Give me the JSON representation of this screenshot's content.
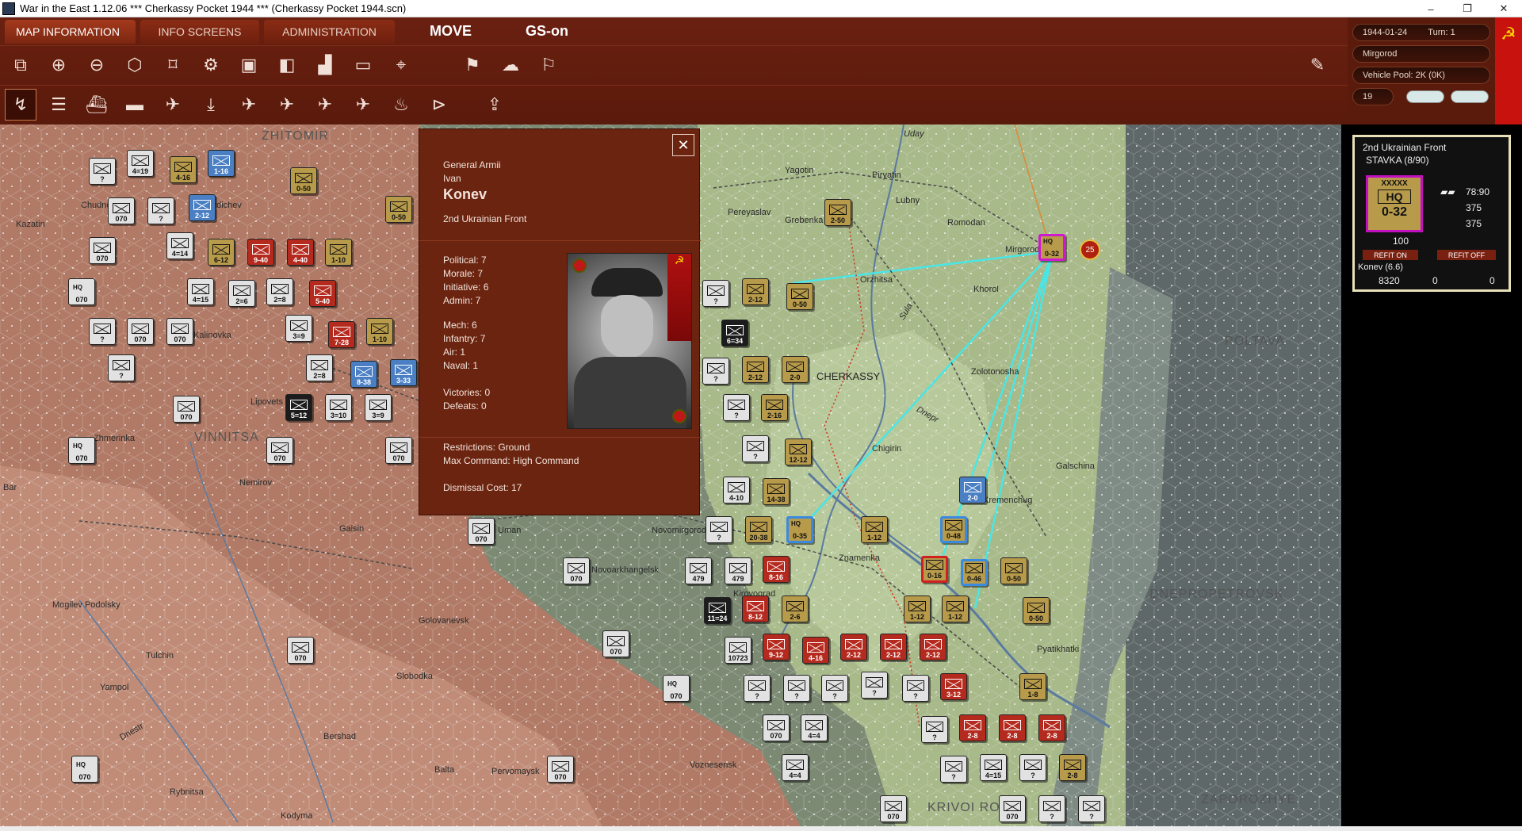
{
  "window": {
    "title": "War in the East 1.12.06       ***   Cherkassy Pocket 1944   ***   (Cherkassy Pocket 1944.scn)",
    "controls": [
      "–",
      "❐",
      "✕"
    ]
  },
  "menu": {
    "tabs": [
      "MAP INFORMATION",
      "INFO SCREENS",
      "ADMINISTRATION"
    ],
    "mode": "MOVE",
    "gs": "GS-on"
  },
  "toolbar_row1_icons": [
    "window-icon",
    "zoom-in-icon",
    "zoom-out-icon",
    "hexes-icon",
    "frame-icon",
    "gear-icon",
    "unit-stack-icon",
    "layers-icon",
    "chart-icon",
    "rectangle-icon",
    "focus-icon",
    "flag-box-icon",
    "weather-icon",
    "flag-icon",
    "pencil-icon"
  ],
  "toolbar_row2": {
    "keys": [
      "F1",
      "F2",
      "F3",
      "F4",
      "F5",
      "F6",
      "F7",
      "F8",
      "F9",
      "F10",
      "F11",
      "F12"
    ],
    "icons": [
      "move-mode-icon",
      "rail-icon",
      "naval-icon",
      "naval-transport-icon",
      "air-icon",
      "paradrop-icon",
      "air-attack-icon",
      "air-supply-icon",
      "bomb-icon",
      "recon-icon",
      "fire-icon",
      "play-icon",
      "upload-icon"
    ]
  },
  "status": {
    "date": "1944-01-24",
    "turn": "Turn: 1",
    "location": "Mirgorod",
    "vehicle_pool": "Vehicle Pool: 2K (0K)",
    "value": "19"
  },
  "commander": {
    "rank": "General Armii",
    "first_name": "Ivan",
    "last_name": "Konev",
    "command": "2nd Ukrainian Front",
    "political": "Political:   7",
    "morale": "Morale:    7",
    "initiative": "Initiative:   6",
    "admin": "Admin:     7",
    "mech": "Mech:      6",
    "infantry": "Infantry:   7",
    "air": "Air:          1",
    "naval": "Naval:      1",
    "victories": "Victories:    0",
    "defeats": "Defeats:      0",
    "restrictions": "Restrictions:      Ground",
    "max_command": "Max Command:    High Command",
    "dismissal": "Dismissal Cost:   17"
  },
  "hq_panel": {
    "name": "2nd Ukrainian Front",
    "parent": "STAVKA  (8/90)",
    "symbol": "XXXXX",
    "hq_label": "HQ",
    "value": "0-32",
    "stat1": "78:90",
    "stat2": "375",
    "stat3": "375",
    "stat4": "100",
    "refit_on": "REFIT ON",
    "refit_off": "REFIT OFF",
    "leader": "Konev (6.6)",
    "men": "8320",
    "planes": "0",
    "tanks": "0"
  },
  "map_labels": {
    "cities": [
      {
        "name": "ZHITOMIR"
      },
      {
        "name": "VINNITSA"
      },
      {
        "name": "CHERKASSY"
      },
      {
        "name": "DNEPROPETROVSK"
      },
      {
        "name": "KRIVOI ROG"
      },
      {
        "name": "ZAPOROZHYE"
      },
      {
        "name": "POLTAVA"
      }
    ],
    "towns": [
      "Yagotin",
      "Piryatin",
      "Lubny",
      "Romodan",
      "Mirgorod",
      "Pereyaslav",
      "Grebenka",
      "Orzhitsa",
      "Khorol",
      "Zolotonosha",
      "Chigirin",
      "Kremenchug",
      "Znamenka",
      "Novomirgorod",
      "Uman",
      "Pyatikhatki",
      "Galschina",
      "Kalinovka",
      "Lipovets",
      "Zhmerinka",
      "Nemirov",
      "Gaisin",
      "Tulchin",
      "Yampol",
      "Bershad",
      "Balta",
      "Kodyma",
      "Rybnitsa",
      "Slobodka",
      "Kirovograd",
      "Novoarkhangelsk",
      "Pervomaysk",
      "Voznesensk",
      "Dnestr",
      "Uday",
      "Sula",
      "Dnepr",
      "Kazatin",
      "Berdichev",
      "Chudnov",
      "Bar",
      "Mogilev Podolsky",
      "Golovanevsk"
    ]
  },
  "units_text": {
    "u1": "4=19",
    "u2": "4-16",
    "u3": "1-16",
    "u4": "0-50",
    "u5": "2-12",
    "u6": "070",
    "u7": "4=14",
    "u8": "6-12",
    "u9": "9-40",
    "u10": "4-40",
    "u11": "1-10",
    "u12": "4=15",
    "u13": "2=6",
    "u14": "2=8",
    "u15": "5-40",
    "u16": "3=9",
    "u17": "7-28",
    "u18": "1-10",
    "u19": "2=8",
    "u20": "8-38",
    "u21": "3-33",
    "u22": "5=12",
    "u23": "3=10",
    "u24": "3=9",
    "u25": "2-50",
    "u26": "2-12",
    "u27": "0-50",
    "u28": "6=34",
    "u29": "2-12",
    "u30": "2-0",
    "u31": "2-16",
    "u32": "12-12",
    "u33": "4-10",
    "u34": "14-38",
    "u35": "20-38",
    "u36": "0-35",
    "u37": "1-12",
    "u38": "0-48",
    "u39": "2-0",
    "u40": "0-16",
    "u41": "0-46",
    "u42": "0-50",
    "u43": "0-50",
    "u44": "479",
    "u45": "479",
    "u46": "8-16",
    "u47": "11=24",
    "u48": "8-12",
    "u49": "2-6",
    "u50": "1-12",
    "u51": "1-12",
    "u52": "10723",
    "u53": "9-12",
    "u54": "4-16",
    "u55": "2-12",
    "u56": "2-12",
    "u57": "2-12",
    "u58": "3-12",
    "u59": "1-8",
    "u60": "4=4",
    "u61": "2-8",
    "u62": "2-8",
    "u63": "2-8",
    "u64": "4=15",
    "u65": "2-8",
    "u66": "4=4",
    "u67": "0-32",
    "u68": "25"
  },
  "hq_marker": "HQ",
  "question": "?"
}
